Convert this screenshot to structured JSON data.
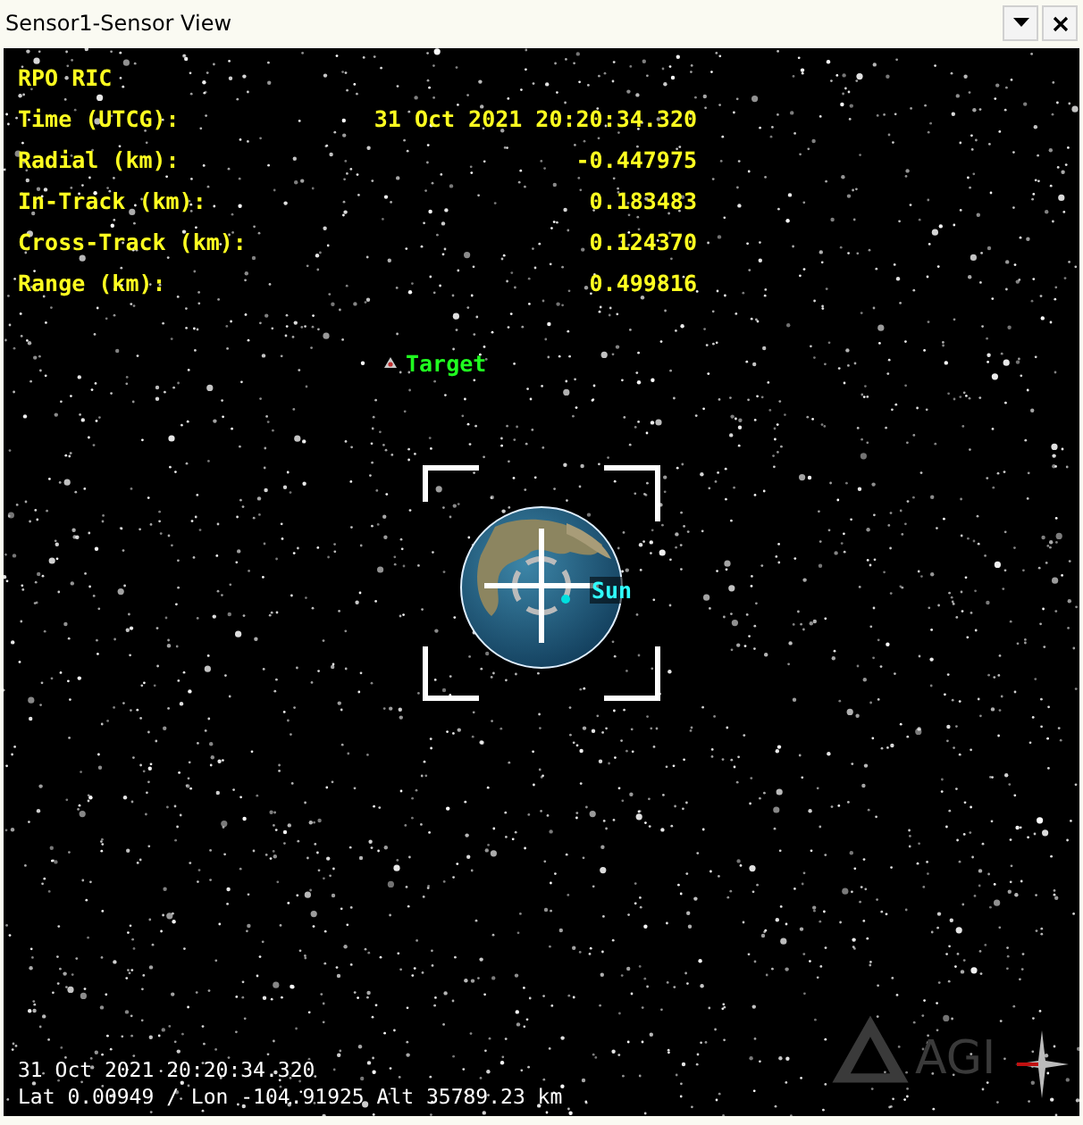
{
  "window": {
    "title": "Sensor1-Sensor View"
  },
  "report": {
    "title": "RPO RIC",
    "rows": [
      {
        "label": "Time (UTCG):",
        "value": "31 Oct 2021 20:20:34.320"
      },
      {
        "label": "Radial (km):",
        "value": "-0.447975"
      },
      {
        "label": "In-Track (km):",
        "value": "0.183483"
      },
      {
        "label": "Cross-Track (km):",
        "value": "0.124370"
      },
      {
        "label": "Range (km):",
        "value": "0.499816"
      }
    ]
  },
  "markers": [
    {
      "kind": "target",
      "label": "Target"
    },
    {
      "kind": "sun",
      "label": "Sun"
    }
  ],
  "footer": {
    "time": "31 Oct 2021 20:20:34.320",
    "position": "Lat 0.00949 / Lon -104.91925  Alt 35789.23 km"
  },
  "logo": {
    "text": "AGI"
  }
}
